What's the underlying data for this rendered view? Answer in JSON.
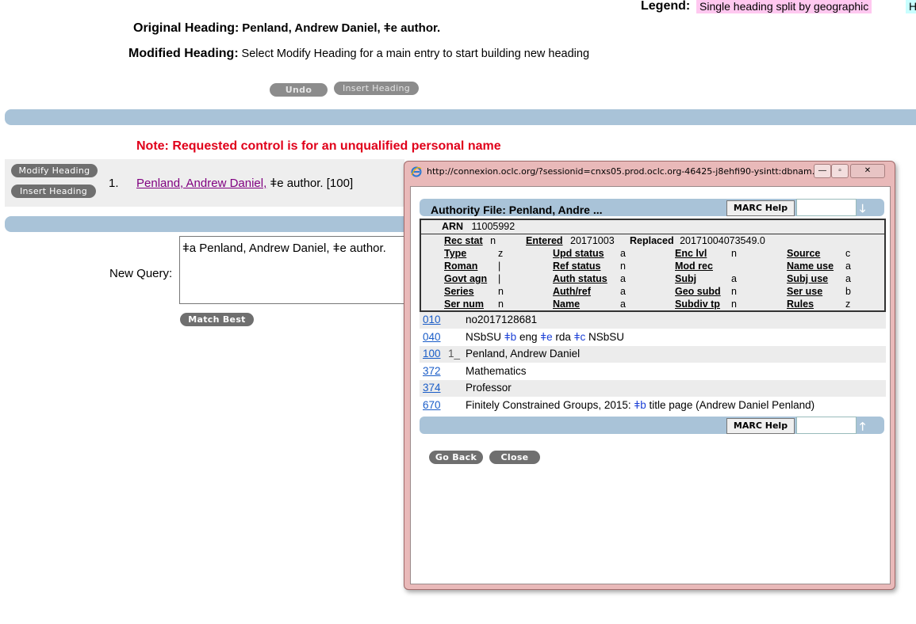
{
  "legend": {
    "label": "Legend:",
    "item1": "Single heading split by geographic",
    "item2": "H"
  },
  "original_heading": {
    "label": "Original Heading:",
    "value": "Penland, Andrew Daniel, ǂe author."
  },
  "modified_heading": {
    "label": "Modified Heading:",
    "value": "Select Modify Heading for a main entry to start building new heading"
  },
  "top_buttons": {
    "undo": "Undo",
    "insert": "Insert Heading"
  },
  "note": "Note: Requested control is for an unqualified personal name",
  "result": {
    "modify_button": "Modify Heading",
    "insert_button": "Insert Heading",
    "number": "1.",
    "link_text": "Penland, Andrew Daniel,",
    "rest_text": " ǂe author. [100]"
  },
  "query": {
    "label": "New Query:",
    "value": "ǂa Penland, Andrew Daniel, ǂe author.",
    "match_button": "Match Best"
  },
  "popup": {
    "url": "http://connexion.oclc.org/?sessionid=cnxs05.prod.oclc.org-46425-j8ehfi90-ysintt:dbnam...",
    "title": "Authority File: Penland, Andre ...",
    "marc_help": "MARC Help",
    "arn_label": "ARN",
    "arn_value": "11005992",
    "rec_stat": {
      "label": "Rec stat",
      "value": "n"
    },
    "entered": {
      "label": "Entered",
      "value": "20171003"
    },
    "replaced": {
      "label": "Replaced",
      "value": "20171004073549.0"
    },
    "fixed": [
      [
        {
          "label": "Type",
          "value": "z"
        },
        {
          "label": "Upd status",
          "value": "a"
        },
        {
          "label": "Enc lvl",
          "value": "n"
        },
        {
          "label": "Source",
          "value": "c"
        }
      ],
      [
        {
          "label": "Roman",
          "value": "|"
        },
        {
          "label": "Ref status",
          "value": "n"
        },
        {
          "label": "Mod rec",
          "value": ""
        },
        {
          "label": "Name use",
          "value": "a"
        }
      ],
      [
        {
          "label": "Govt agn",
          "value": "|"
        },
        {
          "label": "Auth status",
          "value": "a"
        },
        {
          "label": "Subj",
          "value": "a"
        },
        {
          "label": "Subj use",
          "value": "a"
        }
      ],
      [
        {
          "label": "Series",
          "value": "n"
        },
        {
          "label": "Auth/ref",
          "value": "a"
        },
        {
          "label": "Geo subd",
          "value": "n"
        },
        {
          "label": "Ser use",
          "value": "b"
        }
      ],
      [
        {
          "label": "Ser num",
          "value": "n"
        },
        {
          "label": "Name",
          "value": "a"
        },
        {
          "label": "Subdiv tp",
          "value": "n"
        },
        {
          "label": "Rules",
          "value": "z"
        }
      ]
    ],
    "fields": [
      {
        "tag": "010",
        "ind": "",
        "parts": [
          {
            "t": "no2017128681"
          }
        ]
      },
      {
        "tag": "040",
        "ind": "",
        "parts": [
          {
            "t": "NSbSU "
          },
          {
            "t": "ǂb",
            "sub": true
          },
          {
            "t": " eng "
          },
          {
            "t": "ǂe",
            "sub": true
          },
          {
            "t": " rda "
          },
          {
            "t": "ǂc",
            "sub": true
          },
          {
            "t": " NSbSU"
          }
        ]
      },
      {
        "tag": "100",
        "ind": "1_",
        "parts": [
          {
            "t": "Penland, Andrew Daniel"
          }
        ]
      },
      {
        "tag": "372",
        "ind": "",
        "parts": [
          {
            "t": "Mathematics"
          }
        ]
      },
      {
        "tag": "374",
        "ind": "",
        "parts": [
          {
            "t": "Professor"
          }
        ]
      },
      {
        "tag": "670",
        "ind": "",
        "parts": [
          {
            "t": "Finitely Constrained Groups, 2015: "
          },
          {
            "t": "ǂb",
            "sub": true
          },
          {
            "t": " title page (Andrew Daniel Penland)"
          }
        ]
      }
    ],
    "go_back": "Go Back",
    "close": "Close"
  },
  "colors": {
    "legend_pink": "#ffc8f0",
    "legend_cyan": "#c8ffff",
    "bar_blue": "#a9c3d8",
    "note_red": "#e0001a",
    "link_purple": "#800080"
  },
  "icons": {
    "ie": "ie-icon",
    "minimize": "minimize-icon",
    "maximize": "maximize-icon",
    "close": "close-icon",
    "down": "arrow-down-icon",
    "up": "arrow-up-icon"
  }
}
